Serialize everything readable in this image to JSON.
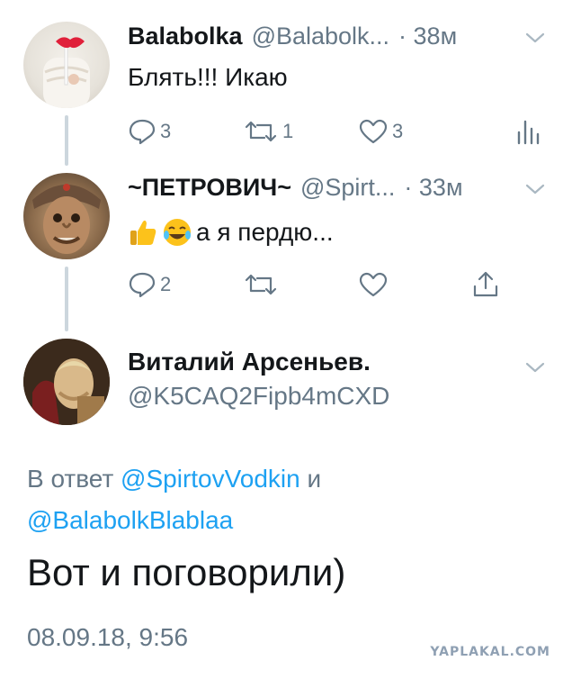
{
  "tweets": [
    {
      "name": "Balabolka",
      "handle": "@Balabolk...",
      "time": "· 38м",
      "text": "Блять!!! Икаю",
      "replies": "3",
      "retweets": "1",
      "likes": "3",
      "last_action_icon": "analytics-icon"
    },
    {
      "name": "~ПЕТРОВИЧ~",
      "handle": "@Spirt...",
      "time": "· 33м",
      "emojis": [
        "thumbs-up-emoji",
        "tears-of-joy-emoji"
      ],
      "text": "а я пердю...",
      "replies": "2",
      "retweets": "",
      "likes": "",
      "last_action_icon": "share-icon"
    }
  ],
  "main_tweet": {
    "name": "Виталий Арсеньев.",
    "handle": "@K5CAQ2Fipb4mCXD",
    "reply_prefix": "В ответ",
    "reply_to_1": "@SpirtovVodkin",
    "reply_and": "и",
    "reply_to_2": "@BalabolkBlablaa",
    "text": "Вот и поговорили)",
    "timestamp": "08.09.18, 9:56"
  },
  "watermark": "YAPLAKAL.COM",
  "colors": {
    "link": "#1da1f2",
    "secondary_text": "#657786",
    "thread_line": "#ccd6dd",
    "icon": "#657786"
  }
}
